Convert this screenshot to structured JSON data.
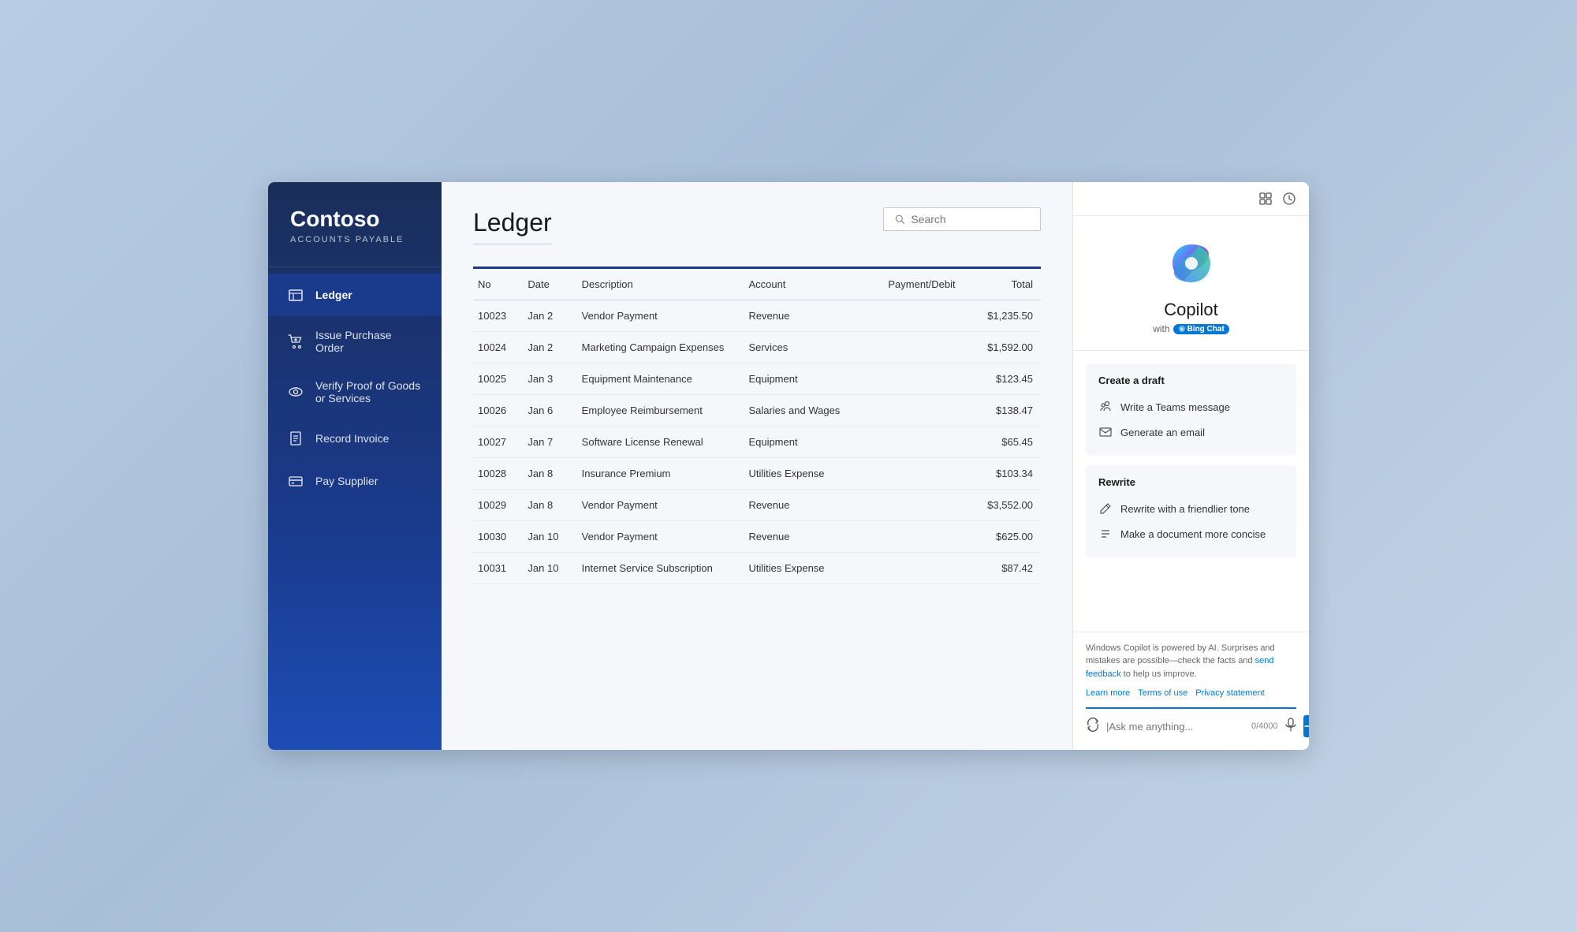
{
  "sidebar": {
    "logo": "Contoso",
    "subtitle": "ACCOUNTS PAYABLE",
    "nav_items": [
      {
        "id": "ledger",
        "label": "Ledger",
        "active": true,
        "icon": "ledger"
      },
      {
        "id": "issue-po",
        "label": "Issue Purchase Order",
        "active": false,
        "icon": "cart"
      },
      {
        "id": "verify",
        "label": "Verify Proof of Goods or Services",
        "active": false,
        "icon": "eye"
      },
      {
        "id": "record-invoice",
        "label": "Record Invoice",
        "active": false,
        "icon": "invoice"
      },
      {
        "id": "pay-supplier",
        "label": "Pay Supplier",
        "active": false,
        "icon": "pay"
      }
    ]
  },
  "main": {
    "page_title": "Ledger",
    "search_placeholder": "Search",
    "table": {
      "columns": [
        "No",
        "Date",
        "Description",
        "Account",
        "Payment/Debit",
        "Total"
      ],
      "rows": [
        {
          "no": "10023",
          "date": "Jan 2",
          "description": "Vendor Payment",
          "account": "Revenue",
          "payment": "",
          "total": "$1,235.50"
        },
        {
          "no": "10024",
          "date": "Jan 2",
          "description": "Marketing Campaign Expenses",
          "account": "Services",
          "payment": "",
          "total": "$1,592.00"
        },
        {
          "no": "10025",
          "date": "Jan 3",
          "description": "Equipment Maintenance",
          "account": "Equipment",
          "payment": "",
          "total": "$123.45"
        },
        {
          "no": "10026",
          "date": "Jan 6",
          "description": "Employee Reimbursement",
          "account": "Salaries and Wages",
          "payment": "",
          "total": "$138.47"
        },
        {
          "no": "10027",
          "date": "Jan 7",
          "description": "Software License Renewal",
          "account": "Equipment",
          "payment": "",
          "total": "$65.45"
        },
        {
          "no": "10028",
          "date": "Jan 8",
          "description": "Insurance Premium",
          "account": "Utilities Expense",
          "payment": "",
          "total": "$103.34"
        },
        {
          "no": "10029",
          "date": "Jan 8",
          "description": "Vendor Payment",
          "account": "Revenue",
          "payment": "",
          "total": "$3,552.00"
        },
        {
          "no": "10030",
          "date": "Jan 10",
          "description": "Vendor Payment",
          "account": "Revenue",
          "payment": "",
          "total": "$625.00"
        },
        {
          "no": "10031",
          "date": "Jan 10",
          "description": "Internet Service Subscription",
          "account": "Utilities Expense",
          "payment": "",
          "total": "$87.42"
        }
      ]
    }
  },
  "copilot": {
    "name": "Copilot",
    "powered_by": "with",
    "bing_label": "Bing Chat",
    "create_draft_title": "Create a draft",
    "suggestions_create": [
      {
        "id": "teams-msg",
        "label": "Write a Teams message",
        "icon": "teams"
      },
      {
        "id": "gen-email",
        "label": "Generate an email",
        "icon": "email"
      }
    ],
    "rewrite_title": "Rewrite",
    "suggestions_rewrite": [
      {
        "id": "friendlier",
        "label": "Rewrite with a friendlier tone",
        "icon": "pen"
      },
      {
        "id": "concise",
        "label": "Make a document more concise",
        "icon": "list"
      }
    ],
    "disclaimer": "Windows Copilot is powered by AI. Surprises and mistakes are possible—check the facts and ",
    "send_feedback_label": "send feedback",
    "disclaimer_end": " to help us improve.",
    "learn_more": "Learn more",
    "terms_of_use": "Terms of use",
    "privacy_statement": "Privacy statement",
    "input_placeholder": "|Ask me anything...",
    "char_count": "0/4000"
  }
}
